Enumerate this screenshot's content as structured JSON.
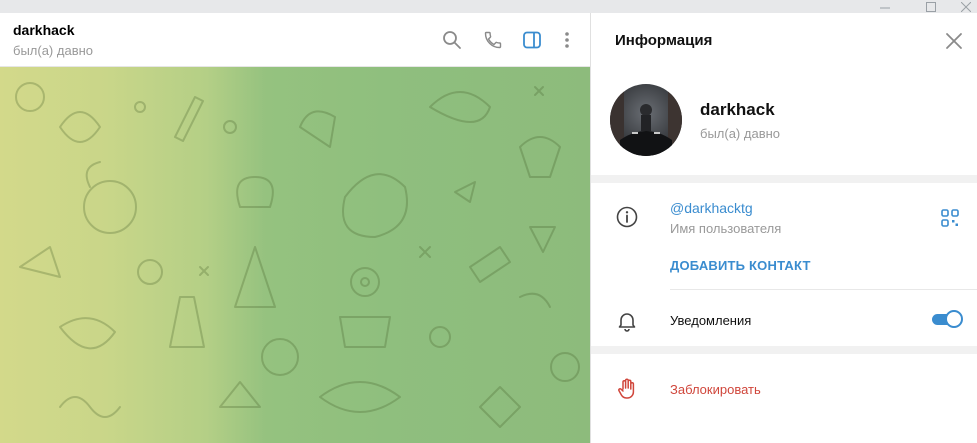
{
  "chat": {
    "name": "darkhack",
    "status": "был(а) давно",
    "icons": [
      "search-icon",
      "phone-icon",
      "sidebar-toggle-icon",
      "more-vertical-icon"
    ]
  },
  "info_panel": {
    "title": "Информация",
    "profile": {
      "name": "darkhack",
      "status": "был(а) давно"
    },
    "username": {
      "value": "@darkhacktg",
      "label": "Имя пользователя"
    },
    "add_contact": "ДОБАВИТЬ КОНТАКТ",
    "notifications": {
      "label": "Уведомления",
      "enabled": true
    },
    "block": "Заблокировать"
  },
  "colors": {
    "accent": "#3a8ccf",
    "danger": "#d0463b",
    "muted_text": "#999999",
    "chat_bg_left": "#d3d98a",
    "chat_bg_right": "#8dbb7c"
  }
}
